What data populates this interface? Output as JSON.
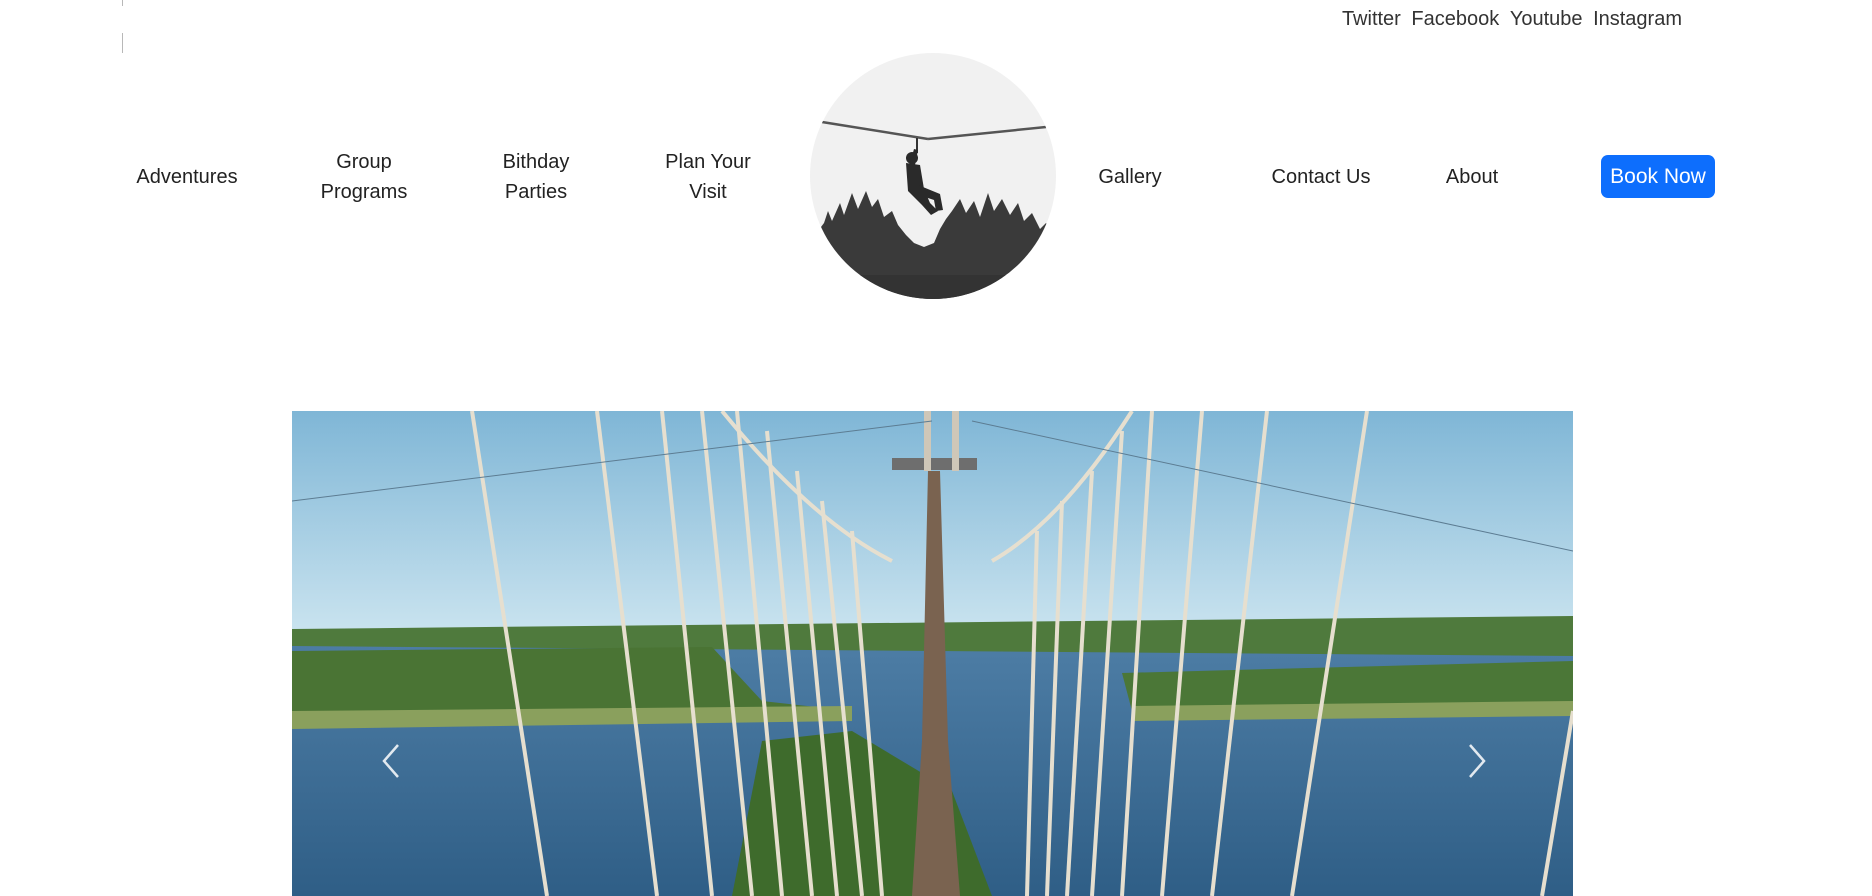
{
  "social": {
    "links": [
      "Twitter",
      "Facebook",
      "Youtube",
      "Instagram"
    ]
  },
  "nav": {
    "adventures": [
      "Adventures"
    ],
    "group_programs": [
      "Group",
      "Programs"
    ],
    "birthday_parties": [
      "Bithday",
      "Parties"
    ],
    "plan_visit": [
      "Plan Your",
      "Visit"
    ],
    "gallery": [
      "Gallery"
    ],
    "contact": [
      "Contact Us"
    ],
    "about": [
      "About"
    ]
  },
  "book_now": "Book Now",
  "colors": {
    "primary": "#0d6efd",
    "text": "#212529"
  },
  "icons": {
    "logo": "zipline-logo",
    "prev": "chevron-left-icon",
    "next": "chevron-right-icon"
  }
}
